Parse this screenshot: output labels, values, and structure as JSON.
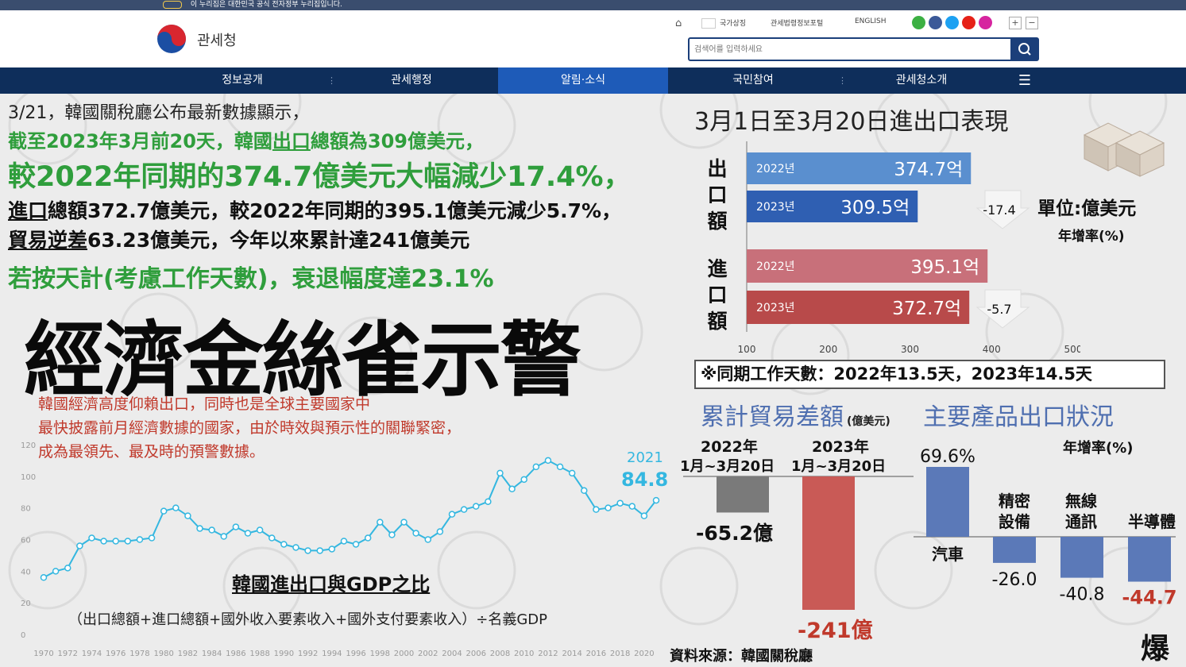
{
  "banner": {
    "text": "이 누리집은 대한민국 공식 전자정부 누리집입니다."
  },
  "header": {
    "logo_text": "관세청",
    "links": [
      "국가상징",
      "관세법령정보포털",
      "ENGLISH"
    ],
    "search_placeholder": "검색어를 입력하세요"
  },
  "nav": {
    "items": [
      "정보공개",
      "관세행정",
      "알림·소식",
      "국민참여",
      "관세청소개"
    ]
  },
  "headline": {
    "line1": "3/21，韓國關稅廳公布最新數據顯示，",
    "line2_pre": "截至2023年3月前20天，韓國",
    "line2_em": "出口",
    "line2_post": "總額為309億美元，",
    "line3": "較2022年同期的374.7億美元大幅減少17.4%，",
    "line4_em": "進口",
    "line4_post": "總額372.7億美元，較2022年同期的395.1億美元減少5.7%，",
    "line5_em": "貿易逆差",
    "line5_post": "63.23億美元，今年以來累計達241億美元",
    "line6": "若按天計(考慮工作天數)，衰退幅度達23.1%"
  },
  "big_title": "經濟金絲雀示警",
  "paragraph": [
    "韓國經濟高度仰賴出口，同時也是全球主要國家中",
    "最快披露前月經濟數據的國家，由於時效與預示性的關聯緊密，",
    "成為最領先、最及時的預警數據。"
  ],
  "bar_panel": {
    "title": "3月1日至3月20日進出口表現",
    "unit_label": "單位:億美元",
    "growth_label": "年增率(%)",
    "export_label": "出口額",
    "import_label": "進口額",
    "workdays_note": "※同期工作天數：2022年13.5天，2023年14.5天"
  },
  "trade_panel": {
    "title": "累計貿易差額",
    "unit": "(億美元)",
    "col1_year": "2022年",
    "col1_range": "1月~3月20日",
    "col2_year": "2023年",
    "col2_range": "1月~3月20日",
    "label1": "-65.2億",
    "label2": "-241億"
  },
  "product_panel": {
    "title": "主要產品出口狀況",
    "growth_label": "年增率(%)"
  },
  "gdp_chart": {
    "title": "韓國進出口與GDP之比",
    "formula": "（出口總額+進口總額+國外收入要素收入+國外支付要素收入）÷名義GDP",
    "callout_year": "2021",
    "callout_value": "84.8"
  },
  "source": "資料來源：韓國關稅廳",
  "corner_logo": "爆",
  "colors": {
    "green": "#2f9e3c",
    "export_2022": "#5a8fcf",
    "export_2023": "#2f5fb2",
    "import_2022": "#c8707a",
    "import_2023": "#b84a4a",
    "trade_2022": "#7a7a7a",
    "trade_2023": "#c95a56",
    "product_bar": "#5b79b8",
    "line": "#34b7e0",
    "red_text": "#c0392b",
    "nav": "#0e2e5b"
  },
  "chart_data": [
    {
      "type": "bar",
      "title": "3月1日至3月20日進出口表現",
      "orientation": "horizontal",
      "unit": "억",
      "xlim": [
        100,
        500
      ],
      "xticks": [
        100,
        200,
        300,
        400,
        500
      ],
      "groups": [
        {
          "name": "出口額",
          "bars": [
            {
              "category": "2022년",
              "value": 374.7,
              "label": "374.7억"
            },
            {
              "category": "2023년",
              "value": 309.5,
              "label": "309.5억"
            }
          ],
          "growth": "-17.4"
        },
        {
          "name": "進口額",
          "bars": [
            {
              "category": "2022년",
              "value": 395.1,
              "label": "395.1억"
            },
            {
              "category": "2023년",
              "value": 372.7,
              "label": "372.7억"
            }
          ],
          "growth": "-5.7"
        }
      ]
    },
    {
      "type": "bar",
      "title": "累計貿易差額",
      "categories": [
        "2022年 1月~3月20日",
        "2023年 1月~3月20日"
      ],
      "values": [
        -65.2,
        -241
      ],
      "ylabel": "(億美元)"
    },
    {
      "type": "bar",
      "title": "主要產品出口狀況",
      "categories": [
        "汽車",
        "精密設備",
        "無線通訊",
        "半導體"
      ],
      "values": [
        69.6,
        -26.0,
        -40.8,
        -44.7
      ],
      "value_labels": [
        "69.6%",
        "-26.0",
        "-40.8",
        "-44.7"
      ],
      "ylabel": "年增率(%)"
    },
    {
      "type": "line",
      "title": "韓國進出口與GDP之比",
      "x": [
        1970,
        1971,
        1972,
        1973,
        1974,
        1975,
        1976,
        1977,
        1978,
        1979,
        1980,
        1981,
        1982,
        1983,
        1984,
        1985,
        1986,
        1987,
        1988,
        1989,
        1990,
        1991,
        1992,
        1993,
        1994,
        1995,
        1996,
        1997,
        1998,
        1999,
        2000,
        2001,
        2002,
        2003,
        2004,
        2005,
        2006,
        2007,
        2008,
        2009,
        2010,
        2011,
        2012,
        2013,
        2014,
        2015,
        2016,
        2017,
        2018,
        2019,
        2020,
        2021
      ],
      "y": [
        36,
        40,
        42,
        56,
        61,
        59,
        59,
        59,
        60,
        61,
        78,
        80,
        75,
        67,
        66,
        62,
        68,
        64,
        66,
        61,
        57,
        55,
        53,
        53,
        54,
        59,
        57,
        61,
        71,
        63,
        71,
        64,
        60,
        65,
        76,
        79,
        81,
        84,
        102,
        92,
        98,
        106,
        110,
        106,
        102,
        91,
        79,
        80,
        83,
        81,
        75,
        84.8
      ],
      "ylim": [
        0,
        120
      ],
      "yticks": [
        0,
        20,
        40,
        60,
        80,
        100,
        120
      ],
      "xticks": [
        1970,
        1972,
        1974,
        1976,
        1978,
        1980,
        1982,
        1984,
        1986,
        1988,
        1990,
        1992,
        1994,
        1996,
        1998,
        2000,
        2002,
        2004,
        2006,
        2008,
        2010,
        2012,
        2014,
        2016,
        2018,
        2020
      ],
      "annotation": {
        "x": 2021,
        "y": 84.8,
        "text": "2021 84.8"
      }
    }
  ]
}
